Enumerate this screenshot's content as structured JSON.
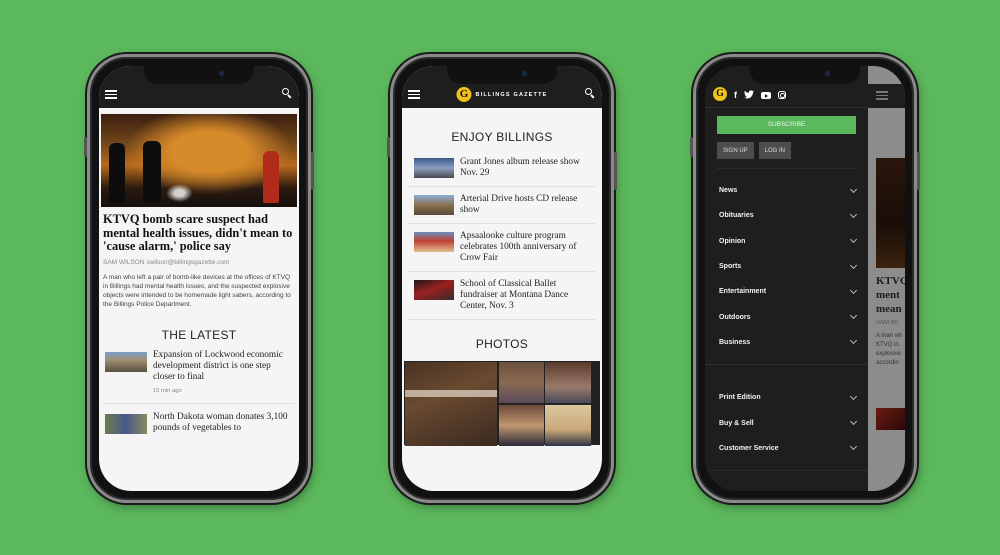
{
  "background_color": "#5cb85c",
  "brand": {
    "name": "BILLINGS GAZETTE",
    "logo_letter": "G",
    "logo_color": "#f2c41a"
  },
  "phone1": {
    "topbar": {
      "menu_icon": "hamburger-icon",
      "search_icon": "search-icon"
    },
    "lead_story": {
      "headline": "KTVQ bomb scare suspect had mental health issues, didn't mean to 'cause alarm,' police say",
      "byline": "SAM WILSON swilson@billingsgazette.com",
      "summary": "A man who left a pair of bomb-like devices at the offices of KTVQ in Billings had mental health issues, and the suspected explosive objects were intended to be homemade light sabers, according to the Billings Police Department."
    },
    "latest": {
      "title": "THE LATEST",
      "items": [
        {
          "title": "Expansion of Lockwood economic development district is one step closer to final",
          "time": "15 min ago"
        },
        {
          "title": "North Dakota woman donates 3,100 pounds of vegetables to",
          "time": ""
        }
      ]
    }
  },
  "phone2": {
    "section_title": "ENJOY BILLINGS",
    "items": [
      {
        "title": "Grant Jones album release show Nov. 29"
      },
      {
        "title": "Arterial Drive hosts CD release show"
      },
      {
        "title": "Apsaalooke culture program celebrates 100th anniversary of Crow Fair"
      },
      {
        "title": "School of Classical Ballet fundraiser at Montana Dance Center, Nov. 3"
      }
    ],
    "photos_title": "PHOTOS"
  },
  "phone3": {
    "social": {
      "facebook": "f"
    },
    "subscribe_label": "SUBSCRIBE",
    "signup_label": "SIGN UP",
    "login_label": "LOG IN",
    "menu_primary": [
      "News",
      "Obituaries",
      "Opinion",
      "Sports",
      "Entertainment",
      "Outdoors",
      "Business"
    ],
    "menu_secondary": [
      "Print Edition",
      "Buy & Sell",
      "Customer Service"
    ],
    "peek": {
      "headline_fragment": "KTVQ\nment\nmean",
      "byline_fragment": "SAM WI",
      "summary_fragment": "A man wh\nKTVQ in\nexplosive\naccordin"
    }
  }
}
